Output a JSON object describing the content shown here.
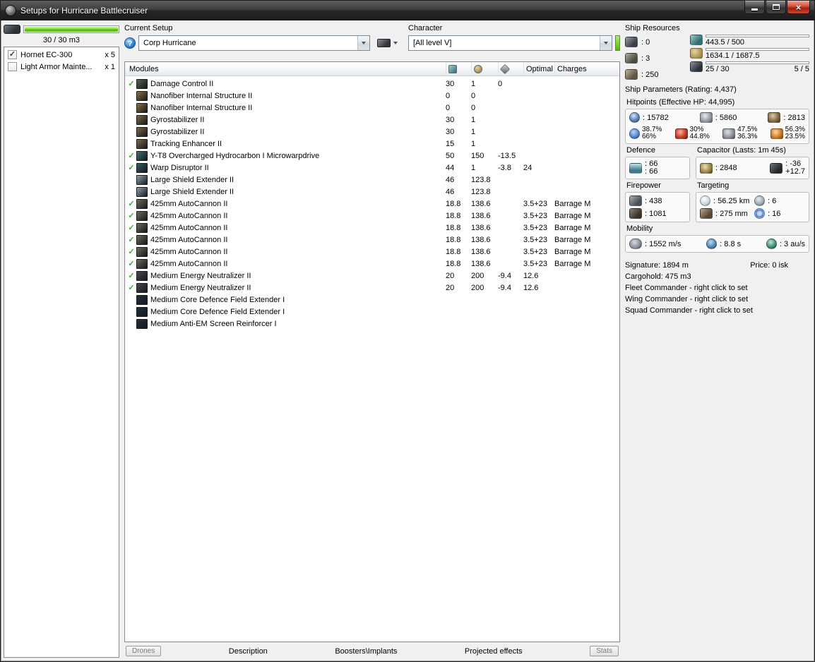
{
  "window": {
    "title": "Setups for Hurricane Battlecruiser"
  },
  "drone_bay": {
    "capacity": "30 / 30 m3",
    "fill_pct": 100,
    "items": [
      {
        "checked": true,
        "label": "Hornet EC-300",
        "qty": "x 5"
      },
      {
        "checked": false,
        "label": "Light Armor Mainte...",
        "qty": "x 1"
      }
    ]
  },
  "setup": {
    "label": "Current Setup",
    "value": "Corp Hurricane"
  },
  "character": {
    "label": "Character",
    "value": "[All level V]"
  },
  "modules": {
    "columns": {
      "name": "Modules",
      "optimal": "Optimal",
      "charges": "Charges"
    },
    "rows": [
      {
        "active": true,
        "icon": "#5a6052",
        "name": "Damage Control II",
        "cpu": "30",
        "pg": "1",
        "cap": "0",
        "optimal": "",
        "charge": ""
      },
      {
        "active": false,
        "icon": "#8a7340",
        "name": "Nanofiber Internal Structure II",
        "cpu": "0",
        "pg": "0",
        "cap": "",
        "optimal": "",
        "charge": ""
      },
      {
        "active": false,
        "icon": "#8a7340",
        "name": "Nanofiber Internal Structure II",
        "cpu": "0",
        "pg": "0",
        "cap": "",
        "optimal": "",
        "charge": ""
      },
      {
        "active": false,
        "icon": "#7d6a45",
        "name": "Gyrostabilizer II",
        "cpu": "30",
        "pg": "1",
        "cap": "",
        "optimal": "",
        "charge": ""
      },
      {
        "active": false,
        "icon": "#7d6a45",
        "name": "Gyrostabilizer II",
        "cpu": "30",
        "pg": "1",
        "cap": "",
        "optimal": "",
        "charge": ""
      },
      {
        "active": false,
        "icon": "#7d6a45",
        "name": "Tracking Enhancer II",
        "cpu": "15",
        "pg": "1",
        "cap": "",
        "optimal": "",
        "charge": ""
      },
      {
        "active": true,
        "icon": "#3f7076",
        "name": "Y-T8 Overcharged Hydrocarbon I Microwarpdrive",
        "cpu": "50",
        "pg": "150",
        "cap": "-13.5",
        "optimal": "",
        "charge": ""
      },
      {
        "active": true,
        "icon": "#2f5f66",
        "name": "Warp Disruptor II",
        "cpu": "44",
        "pg": "1",
        "cap": "-3.8",
        "optimal": "24",
        "charge": ""
      },
      {
        "active": false,
        "icon": "#8fa3b0",
        "name": "Large Shield Extender II",
        "cpu": "46",
        "pg": "123.8",
        "cap": "",
        "optimal": "",
        "charge": ""
      },
      {
        "active": false,
        "icon": "#8fa3b0",
        "name": "Large Shield Extender II",
        "cpu": "46",
        "pg": "123.8",
        "cap": "",
        "optimal": "",
        "charge": ""
      },
      {
        "active": true,
        "icon": "#6e6a5a",
        "name": "425mm AutoCannon II",
        "cpu": "18.8",
        "pg": "138.6",
        "cap": "",
        "optimal": "3.5+23",
        "charge": "Barrage M"
      },
      {
        "active": true,
        "icon": "#6e6a5a",
        "name": "425mm AutoCannon II",
        "cpu": "18.8",
        "pg": "138.6",
        "cap": "",
        "optimal": "3.5+23",
        "charge": "Barrage M"
      },
      {
        "active": true,
        "icon": "#6e6a5a",
        "name": "425mm AutoCannon II",
        "cpu": "18.8",
        "pg": "138.6",
        "cap": "",
        "optimal": "3.5+23",
        "charge": "Barrage M"
      },
      {
        "active": true,
        "icon": "#6e6a5a",
        "name": "425mm AutoCannon II",
        "cpu": "18.8",
        "pg": "138.6",
        "cap": "",
        "optimal": "3.5+23",
        "charge": "Barrage M"
      },
      {
        "active": true,
        "icon": "#6e6a5a",
        "name": "425mm AutoCannon II",
        "cpu": "18.8",
        "pg": "138.6",
        "cap": "",
        "optimal": "3.5+23",
        "charge": "Barrage M"
      },
      {
        "active": true,
        "icon": "#6e6a5a",
        "name": "425mm AutoCannon II",
        "cpu": "18.8",
        "pg": "138.6",
        "cap": "",
        "optimal": "3.5+23",
        "charge": "Barrage M"
      },
      {
        "active": true,
        "icon": "#4a4a52",
        "name": "Medium Energy Neutralizer II",
        "cpu": "20",
        "pg": "200",
        "cap": "-9.4",
        "optimal": "12.6",
        "charge": ""
      },
      {
        "active": true,
        "icon": "#4a4a52",
        "name": "Medium Energy Neutralizer II",
        "cpu": "20",
        "pg": "200",
        "cap": "-9.4",
        "optimal": "12.6",
        "charge": ""
      },
      {
        "active": false,
        "icon": "#22303e",
        "name": "Medium Core Defence Field Extender I",
        "cpu": "",
        "pg": "",
        "cap": "",
        "optimal": "",
        "charge": ""
      },
      {
        "active": false,
        "icon": "#22303e",
        "name": "Medium Core Defence Field Extender I",
        "cpu": "",
        "pg": "",
        "cap": "",
        "optimal": "",
        "charge": ""
      },
      {
        "active": false,
        "icon": "#22303e",
        "name": "Medium Anti-EM Screen Reinforcer I",
        "cpu": "",
        "pg": "",
        "cap": "",
        "optimal": "",
        "charge": ""
      }
    ]
  },
  "tabs": [
    {
      "label": "Drones"
    },
    {
      "label": "Description"
    },
    {
      "label": "Boosters\\Implants"
    },
    {
      "label": "Projected effects"
    },
    {
      "label": "Stats"
    }
  ],
  "resources": {
    "title": "Ship Resources",
    "slots": [
      {
        "name": "turret-hardpoints",
        "value": ": 0"
      },
      {
        "name": "launcher-hardpoints",
        "value": ": 3"
      },
      {
        "name": "calibration",
        "value": ": 250"
      }
    ],
    "bars": [
      {
        "name": "cpu",
        "text": "443.5 / 500",
        "pct": 88.7
      },
      {
        "name": "powergrid",
        "text": "1634.1 / 1687.5",
        "pct": 96.8
      },
      {
        "name": "drone-bandwidth",
        "text": "25 / 30",
        "right_text": "5 / 5",
        "pct": 83.3
      }
    ]
  },
  "parameters": {
    "title": "Ship Parameters (Rating: 4,437)",
    "hitpoints": {
      "title": "Hitpoints (Effective HP: 44,995)",
      "shield": ": 15782",
      "armor": ": 5860",
      "structure": ": 2813",
      "resists": [
        {
          "name": "em",
          "top": "38.7%",
          "bottom": "66%"
        },
        {
          "name": "thermal",
          "top": "30%",
          "bottom": "44.8%"
        },
        {
          "name": "kinetic",
          "top": "47.5%",
          "bottom": "36.3%"
        },
        {
          "name": "explosive",
          "top": "56.3%",
          "bottom": "23.5%"
        }
      ]
    },
    "defence": {
      "title": "Defence",
      "value1": ": 66",
      "value2": ": 66"
    },
    "capacitor": {
      "title": "Capacitor (Lasts: 1m 45s)",
      "amount": ": 2848",
      "drain": ": -36",
      "recharge": "+12.7"
    },
    "firepower": {
      "title": "Firepower",
      "volley": ": 438",
      "dps": ": 1081"
    },
    "targeting": {
      "title": "Targeting",
      "range": ": 56.25 km",
      "max_targets": ": 6",
      "scan_resolution": ": 275 mm",
      "sensor_strength": ": 16"
    },
    "mobility": {
      "title": "Mobility",
      "speed": ": 1552 m/s",
      "align_time": ": 8.8 s",
      "warp_speed": ": 3 au/s"
    }
  },
  "info": {
    "signature": "Signature: 1894 m",
    "price": "Price: 0 isk",
    "cargohold": "Cargohold: 475 m3",
    "fleet": "Fleet Commander - right click to set",
    "wing": "Wing Commander - right click to set",
    "squad": "Squad Commander - right click to set"
  },
  "colors": {
    "accent_green": "#74cd28",
    "active_check": "#2db52d",
    "close_button": "#b02a16"
  }
}
